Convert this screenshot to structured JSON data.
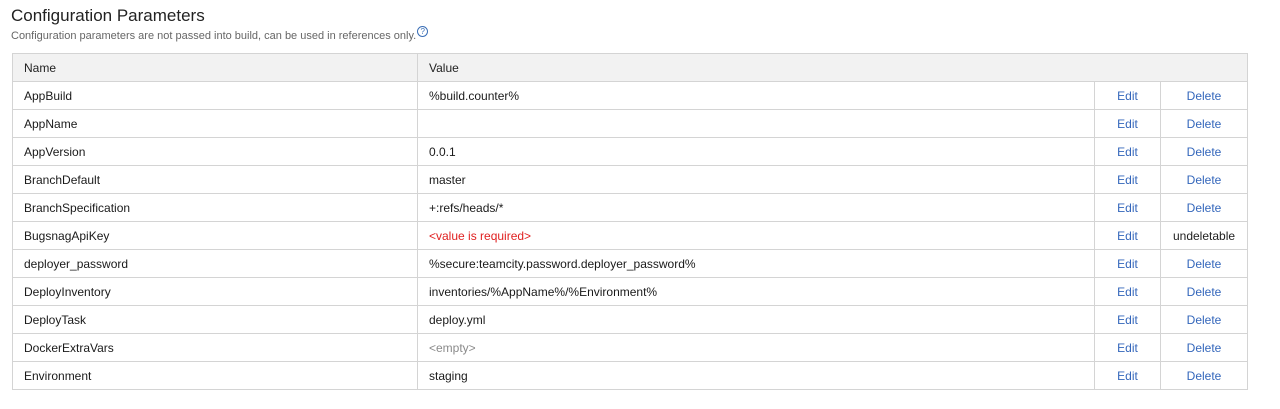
{
  "section": {
    "title": "Configuration Parameters",
    "description": "Configuration parameters are not passed into build, can be used in references only.",
    "help_icon": "?"
  },
  "table": {
    "headers": {
      "name": "Name",
      "value": "Value"
    },
    "rows": [
      {
        "name": "AppBuild",
        "value": "%build.counter%",
        "value_kind": "normal",
        "edit": "Edit",
        "delete": "Delete",
        "deletable": true
      },
      {
        "name": "AppName",
        "value": "",
        "value_kind": "normal",
        "edit": "Edit",
        "delete": "Delete",
        "deletable": true
      },
      {
        "name": "AppVersion",
        "value": "0.0.1",
        "value_kind": "normal",
        "edit": "Edit",
        "delete": "Delete",
        "deletable": true
      },
      {
        "name": "BranchDefault",
        "value": "master",
        "value_kind": "normal",
        "edit": "Edit",
        "delete": "Delete",
        "deletable": true
      },
      {
        "name": "BranchSpecification",
        "value": "+:refs/heads/*",
        "value_kind": "normal",
        "edit": "Edit",
        "delete": "Delete",
        "deletable": true
      },
      {
        "name": "BugsnagApiKey",
        "value": "<value is required>",
        "value_kind": "required",
        "edit": "Edit",
        "delete": "undeletable",
        "deletable": false
      },
      {
        "name": "deployer_password",
        "value": "%secure:teamcity.password.deployer_password%",
        "value_kind": "normal",
        "edit": "Edit",
        "delete": "Delete",
        "deletable": true
      },
      {
        "name": "DeployInventory",
        "value": "inventories/%AppName%/%Environment%",
        "value_kind": "normal",
        "edit": "Edit",
        "delete": "Delete",
        "deletable": true
      },
      {
        "name": "DeployTask",
        "value": "deploy.yml",
        "value_kind": "normal",
        "edit": "Edit",
        "delete": "Delete",
        "deletable": true
      },
      {
        "name": "DockerExtraVars",
        "value": "<empty>",
        "value_kind": "empty",
        "edit": "Edit",
        "delete": "Delete",
        "deletable": true
      },
      {
        "name": "Environment",
        "value": "staging",
        "value_kind": "normal",
        "edit": "Edit",
        "delete": "Delete",
        "deletable": true
      }
    ]
  },
  "colors": {
    "link": "#3366bb",
    "required": "#e02020",
    "empty": "#8a8a8a",
    "header_bg": "#f2f2f2",
    "border": "#d4d4d4"
  }
}
